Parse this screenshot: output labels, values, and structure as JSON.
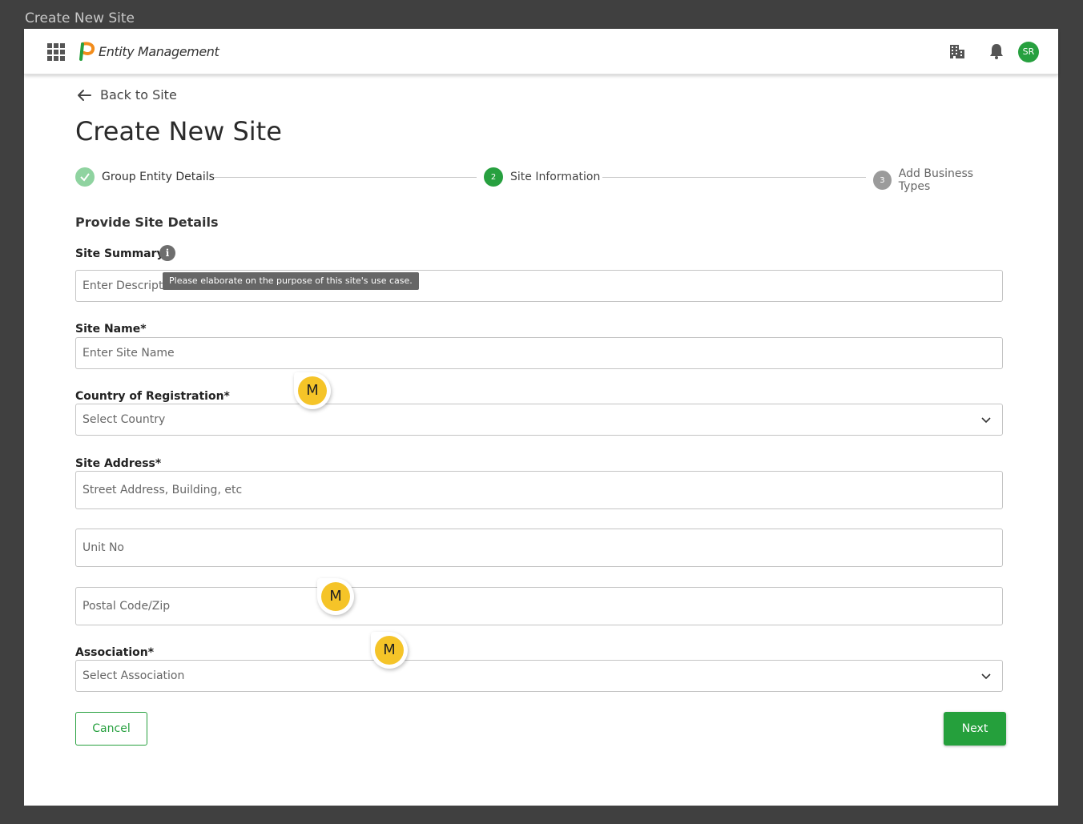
{
  "window": {
    "title": "Create New Site"
  },
  "appbar": {
    "app_name": "Entity Management",
    "avatar_initials": "SR",
    "icons": [
      "apps-grid-icon",
      "logo",
      "building-icon",
      "bell-icon"
    ]
  },
  "header": {
    "back_label": "Back to Site",
    "page_title": "Create New Site"
  },
  "stepper": {
    "steps": [
      {
        "number": "1",
        "label": "Group Entity Details",
        "state": "completed"
      },
      {
        "number": "2",
        "label": "Site Information",
        "state": "active"
      },
      {
        "number": "3",
        "label": "Add Business Types",
        "state": "pending"
      }
    ]
  },
  "form": {
    "section_title": "Provide Site Details",
    "site_summary": {
      "label": "Site Summary",
      "placeholder": "Enter Descripti",
      "tooltip": "Please elaborate on the purpose of this site's use case."
    },
    "site_name": {
      "label": "Site Name*",
      "placeholder": "Enter Site Name"
    },
    "country": {
      "label": "Country of Registration*",
      "placeholder": "Select Country"
    },
    "site_address": {
      "label": "Site Address*",
      "street_placeholder": "Street Address, Building, etc",
      "unit_placeholder": "Unit No",
      "postal_placeholder": "Postal Code/Zip"
    },
    "association": {
      "label": "Association*",
      "placeholder": "Select Association"
    }
  },
  "markers": {
    "label": "M"
  },
  "actions": {
    "cancel_label": "Cancel",
    "next_label": "Next"
  },
  "colors": {
    "primary_green": "#27a03f",
    "marker_yellow": "#f5c428",
    "background": "#404040"
  }
}
